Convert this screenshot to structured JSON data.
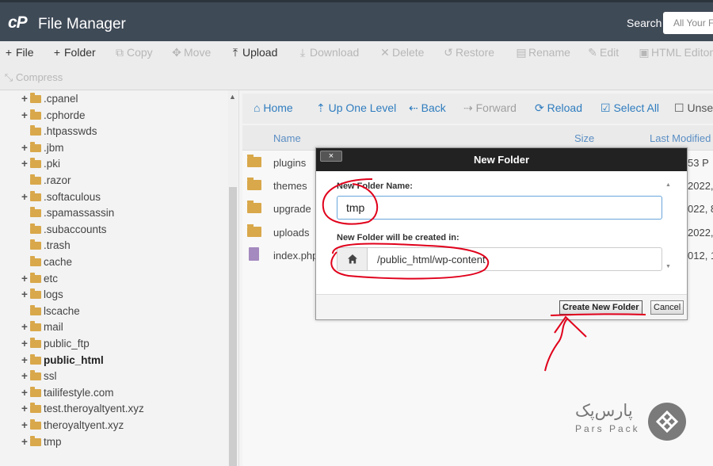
{
  "header": {
    "app_title": "File Manager",
    "search_label": "Search",
    "search_select": "All Your F"
  },
  "toolbar": {
    "file": "File",
    "folder": "Folder",
    "copy": "Copy",
    "move": "Move",
    "upload": "Upload",
    "download": "Download",
    "delete": "Delete",
    "restore": "Restore",
    "rename": "Rename",
    "edit": "Edit",
    "html_editor": "HTML Editor",
    "compress": "Compress"
  },
  "tree": [
    {
      "label": ".cpanel",
      "expandable": true
    },
    {
      "label": ".cphorde",
      "expandable": true
    },
    {
      "label": ".htpasswds",
      "expandable": false
    },
    {
      "label": ".jbm",
      "expandable": true
    },
    {
      "label": ".pki",
      "expandable": true
    },
    {
      "label": ".razor",
      "expandable": false
    },
    {
      "label": ".softaculous",
      "expandable": true
    },
    {
      "label": ".spamassassin",
      "expandable": false
    },
    {
      "label": ".subaccounts",
      "expandable": false
    },
    {
      "label": ".trash",
      "expandable": false
    },
    {
      "label": "cache",
      "expandable": false
    },
    {
      "label": "etc",
      "expandable": true
    },
    {
      "label": "logs",
      "expandable": true
    },
    {
      "label": "lscache",
      "expandable": false
    },
    {
      "label": "mail",
      "expandable": true
    },
    {
      "label": "public_ftp",
      "expandable": true
    },
    {
      "label": "public_html",
      "expandable": true,
      "bold": true
    },
    {
      "label": "ssl",
      "expandable": true
    },
    {
      "label": "tailifestyle.com",
      "expandable": true
    },
    {
      "label": "test.theroyaltyent.xyz",
      "expandable": true
    },
    {
      "label": "theroyaltyent.xyz",
      "expandable": true
    },
    {
      "label": "tmp",
      "expandable": true
    }
  ],
  "nav": {
    "home": "Home",
    "up": "Up One Level",
    "back": "Back",
    "forward": "Forward",
    "reload": "Reload",
    "select_all": "Select All",
    "unselect": "Unse"
  },
  "columns": {
    "name": "Name",
    "size": "Size",
    "modified": "Last Modified"
  },
  "files": [
    {
      "name": "plugins",
      "date": "53 P"
    },
    {
      "name": "themes",
      "date": "2022,"
    },
    {
      "name": "upgrade",
      "date": "022, 8"
    },
    {
      "name": "uploads",
      "date": "2022,"
    },
    {
      "name": "index.php",
      "date": "012, 1"
    }
  ],
  "dialog": {
    "title": "New Folder",
    "close": "×",
    "name_label": "New Folder Name:",
    "name_value": "tmp",
    "location_label": "New Folder will be created in:",
    "location_value": "/public_html/wp-content",
    "create_button": "Create New Folder",
    "cancel_button": "Cancel"
  },
  "brand": {
    "name_fa": "پارس‌پک",
    "name_en": "Pars Pack"
  },
  "colors": {
    "header_bg": "#3f4a57",
    "link_blue": "#2f7dbf",
    "folder": "#d9a84b",
    "annotation_red": "#e0001b"
  }
}
